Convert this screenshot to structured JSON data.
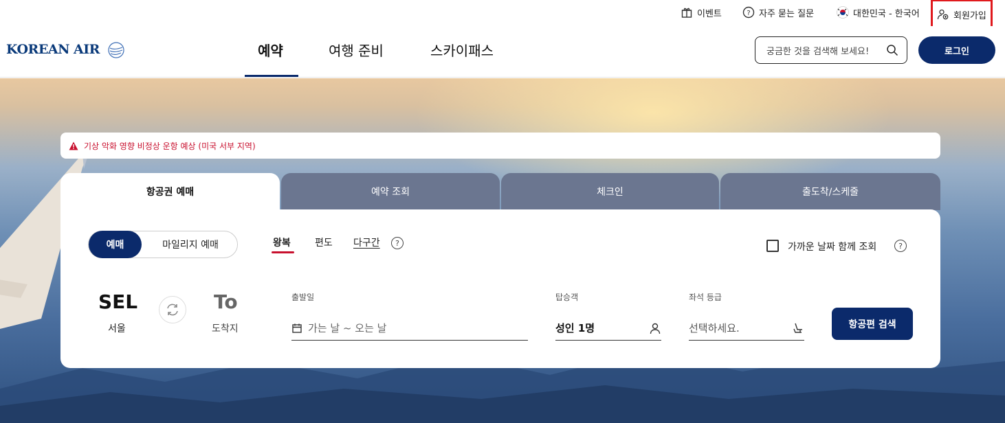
{
  "utility": {
    "event": "이벤트",
    "faq": "자주 묻는 질문",
    "region": "대한민국 - 한국어",
    "signup": "회원가입"
  },
  "header": {
    "logo_text": "KOREAN AIR",
    "nav": [
      "예약",
      "여행 준비",
      "스카이패스"
    ],
    "search_placeholder": "궁금한 것을 검색해 보세요!",
    "login": "로그인"
  },
  "notice": "기상 악화 영향 비정상 운항 예상 (미국 서부 지역)",
  "tabs": [
    "항공권 예매",
    "예약 조회",
    "체크인",
    "출도착/스케줄"
  ],
  "booking": {
    "toggle_on": "예매",
    "toggle_off": "마일리지 예매",
    "trip_types": [
      "왕복",
      "편도",
      "다구간"
    ],
    "help_mark": "?",
    "nearby_dates": "가까운 날짜 함께 조회",
    "origin_code": "SEL",
    "origin_city": "서울",
    "dest_code": "To",
    "dest_city": "도착지",
    "date_label": "출발일",
    "date_placeholder": "가는 날 ~ 오는 날",
    "pax_label": "탑승객",
    "pax_value": "성인 1명",
    "class_label": "좌석 등급",
    "class_placeholder": "선택하세요.",
    "search_button": "항공편 검색"
  },
  "colors": {
    "brand_navy": "#0b2a6b",
    "alert_red": "#c8102e",
    "tab_inactive": "#6b7690"
  }
}
